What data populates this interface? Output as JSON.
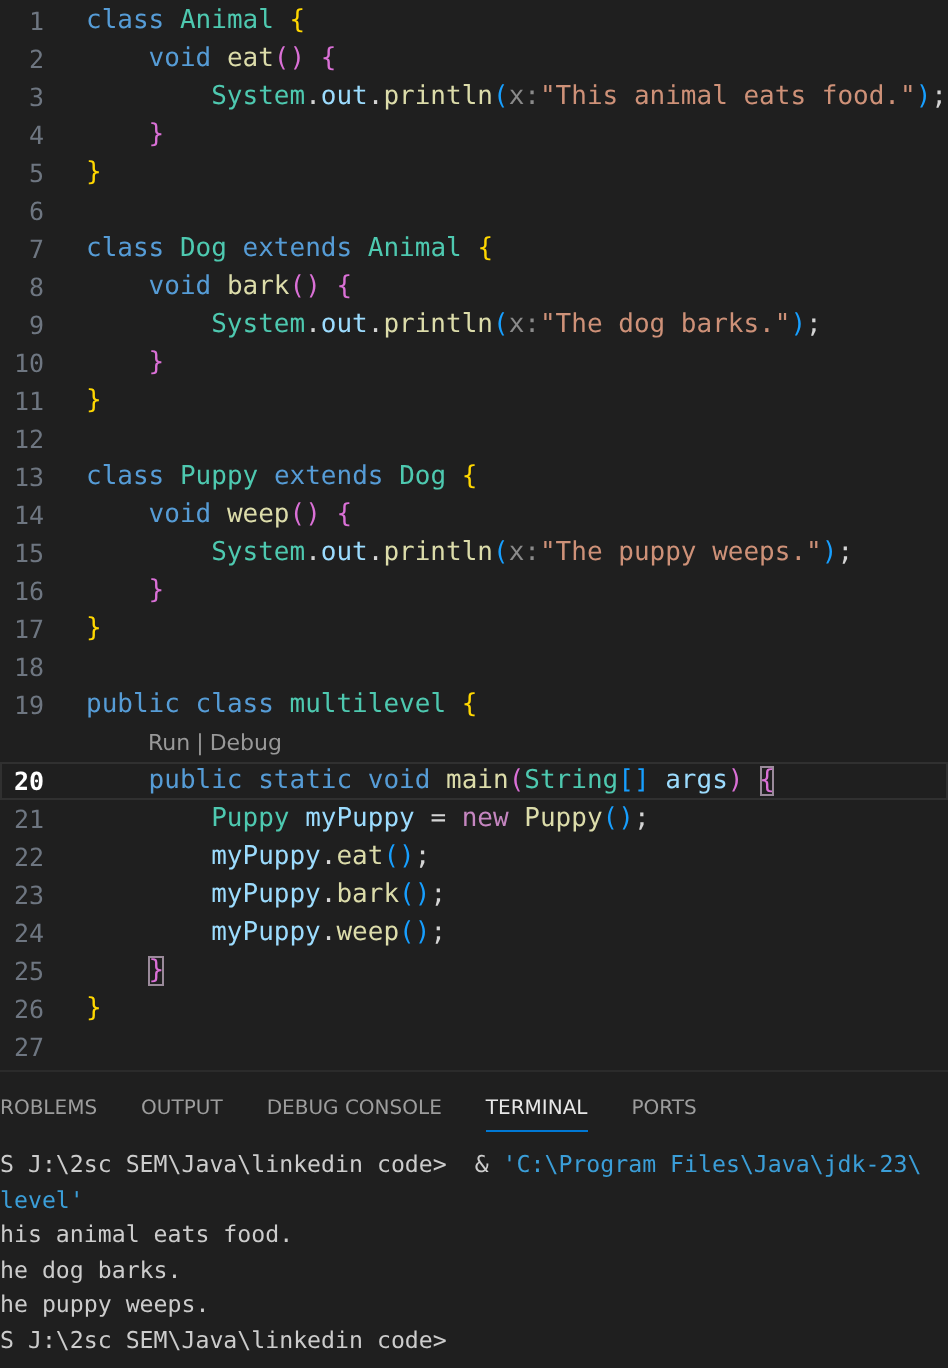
{
  "editor": {
    "lines": [
      {
        "kind": "code",
        "number": "1",
        "active": false,
        "tokens": [
          {
            "text": "class ",
            "kind": "keyword"
          },
          {
            "text": "Animal ",
            "kind": "type"
          },
          {
            "text": "{",
            "kind": "brace1"
          }
        ]
      },
      {
        "kind": "code",
        "number": "2",
        "active": false,
        "tokens": [
          {
            "text": "void ",
            "kind": "keyword"
          },
          {
            "text": "eat",
            "kind": "function"
          },
          {
            "text": "() {",
            "kind": "brace2"
          }
        ]
      },
      {
        "kind": "code",
        "number": "3",
        "active": false,
        "tokens": [
          {
            "text": "System",
            "kind": "type"
          },
          {
            "text": ".",
            "kind": "plain"
          },
          {
            "text": "out",
            "kind": "variable"
          },
          {
            "text": ".",
            "kind": "plain"
          },
          {
            "text": "println",
            "kind": "function"
          },
          {
            "text": "(",
            "kind": "brace3"
          },
          {
            "text": "x:",
            "kind": "hint"
          },
          {
            "text": "\"This animal eats food.\"",
            "kind": "string"
          },
          {
            "text": ")",
            "kind": "brace3"
          },
          {
            "text": ";",
            "kind": "plain"
          }
        ]
      },
      {
        "kind": "code",
        "number": "4",
        "active": false,
        "tokens": [
          {
            "text": "}",
            "kind": "brace2"
          }
        ]
      },
      {
        "kind": "code",
        "number": "5",
        "active": false,
        "tokens": [
          {
            "text": "}",
            "kind": "brace1"
          }
        ]
      },
      {
        "kind": "code",
        "number": "6",
        "active": false
      },
      {
        "kind": "code",
        "number": "7",
        "active": false,
        "tokens": [
          {
            "text": "class ",
            "kind": "keyword"
          },
          {
            "text": "Dog ",
            "kind": "type"
          },
          {
            "text": "extends ",
            "kind": "keyword"
          },
          {
            "text": "Animal ",
            "kind": "type"
          },
          {
            "text": "{",
            "kind": "brace1"
          }
        ]
      },
      {
        "kind": "code",
        "number": "8",
        "active": false,
        "tokens": [
          {
            "text": "void ",
            "kind": "keyword"
          },
          {
            "text": "bark",
            "kind": "function"
          },
          {
            "text": "() {",
            "kind": "brace2"
          }
        ]
      },
      {
        "kind": "code",
        "number": "9",
        "active": false,
        "tokens": [
          {
            "text": "System",
            "kind": "type"
          },
          {
            "text": ".",
            "kind": "plain"
          },
          {
            "text": "out",
            "kind": "variable"
          },
          {
            "text": ".",
            "kind": "plain"
          },
          {
            "text": "println",
            "kind": "function"
          },
          {
            "text": "(",
            "kind": "brace3"
          },
          {
            "text": "x:",
            "kind": "hint"
          },
          {
            "text": "\"The dog barks.\"",
            "kind": "string"
          },
          {
            "text": ")",
            "kind": "brace3"
          },
          {
            "text": ";",
            "kind": "plain"
          }
        ]
      },
      {
        "kind": "code",
        "number": "10",
        "active": false,
        "tokens": [
          {
            "text": "}",
            "kind": "brace2"
          }
        ]
      },
      {
        "kind": "code",
        "number": "11",
        "active": false,
        "tokens": [
          {
            "text": "}",
            "kind": "brace1"
          }
        ]
      },
      {
        "kind": "code",
        "number": "12",
        "active": false
      },
      {
        "kind": "code",
        "number": "13",
        "active": false,
        "tokens": [
          {
            "text": "class ",
            "kind": "keyword"
          },
          {
            "text": "Puppy ",
            "kind": "type"
          },
          {
            "text": "extends ",
            "kind": "keyword"
          },
          {
            "text": "Dog ",
            "kind": "type"
          },
          {
            "text": "{",
            "kind": "brace1"
          }
        ]
      },
      {
        "kind": "code",
        "number": "14",
        "active": false,
        "tokens": [
          {
            "text": "void ",
            "kind": "keyword"
          },
          {
            "text": "weep",
            "kind": "function"
          },
          {
            "text": "() {",
            "kind": "brace2"
          }
        ]
      },
      {
        "kind": "code",
        "number": "15",
        "active": false,
        "tokens": [
          {
            "text": "System",
            "kind": "type"
          },
          {
            "text": ".",
            "kind": "plain"
          },
          {
            "text": "out",
            "kind": "variable"
          },
          {
            "text": ".",
            "kind": "plain"
          },
          {
            "text": "println",
            "kind": "function"
          },
          {
            "text": "(",
            "kind": "brace3"
          },
          {
            "text": "x:",
            "kind": "hint"
          },
          {
            "text": "\"The puppy weeps.\"",
            "kind": "string"
          },
          {
            "text": ")",
            "kind": "brace3"
          },
          {
            "text": ";",
            "kind": "plain"
          }
        ]
      },
      {
        "kind": "code",
        "number": "16",
        "active": false,
        "tokens": [
          {
            "text": "}",
            "kind": "brace2"
          }
        ]
      },
      {
        "kind": "code",
        "number": "17",
        "active": false,
        "tokens": [
          {
            "text": "}",
            "kind": "brace1"
          }
        ]
      },
      {
        "kind": "code",
        "number": "18",
        "active": false
      },
      {
        "kind": "code",
        "number": "19",
        "active": false,
        "tokens": [
          {
            "text": "public class ",
            "kind": "keyword"
          },
          {
            "text": "multilevel ",
            "kind": "type"
          },
          {
            "text": "{",
            "kind": "brace1"
          }
        ]
      },
      {
        "kind": "codelens",
        "links": [
          "Run",
          "Debug"
        ],
        "separator": "|"
      },
      {
        "kind": "code",
        "number": "20",
        "active": true,
        "tokens": [
          {
            "text": "public static void ",
            "kind": "keyword"
          },
          {
            "text": "main",
            "kind": "function"
          },
          {
            "text": "(",
            "kind": "brace2"
          },
          {
            "text": "String",
            "kind": "type"
          },
          {
            "text": "[] ",
            "kind": "brace3"
          },
          {
            "text": "args",
            "kind": "variable"
          },
          {
            "text": ") ",
            "kind": "brace2"
          },
          {
            "text": "{",
            "kind": "match"
          }
        ]
      },
      {
        "kind": "code",
        "number": "21",
        "active": false,
        "tokens": [
          {
            "text": "Puppy ",
            "kind": "type"
          },
          {
            "text": "myPuppy ",
            "kind": "variable"
          },
          {
            "text": "= ",
            "kind": "plain"
          },
          {
            "text": "new ",
            "kind": "control"
          },
          {
            "text": "Puppy",
            "kind": "function"
          },
          {
            "text": "()",
            "kind": "brace3"
          },
          {
            "text": ";",
            "kind": "plain"
          }
        ]
      },
      {
        "kind": "code",
        "number": "22",
        "active": false,
        "tokens": [
          {
            "text": "myPuppy",
            "kind": "variable"
          },
          {
            "text": ".",
            "kind": "plain"
          },
          {
            "text": "eat",
            "kind": "function"
          },
          {
            "text": "()",
            "kind": "brace3"
          },
          {
            "text": ";",
            "kind": "plain"
          }
        ]
      },
      {
        "kind": "code",
        "number": "23",
        "active": false,
        "tokens": [
          {
            "text": "myPuppy",
            "kind": "variable"
          },
          {
            "text": ".",
            "kind": "plain"
          },
          {
            "text": "bark",
            "kind": "function"
          },
          {
            "text": "()",
            "kind": "brace3"
          },
          {
            "text": ";",
            "kind": "plain"
          }
        ]
      },
      {
        "kind": "code",
        "number": "24",
        "active": false,
        "tokens": [
          {
            "text": "myPuppy",
            "kind": "variable"
          },
          {
            "text": ".",
            "kind": "plain"
          },
          {
            "text": "weep",
            "kind": "function"
          },
          {
            "text": "()",
            "kind": "brace3"
          },
          {
            "text": ";",
            "kind": "plain"
          }
        ]
      },
      {
        "kind": "code",
        "number": "25",
        "active": false,
        "tokens": [
          {
            "text": "}",
            "kind": "match"
          }
        ]
      },
      {
        "kind": "code",
        "number": "26",
        "active": false,
        "tokens": [
          {
            "text": "}",
            "kind": "brace1"
          }
        ]
      },
      {
        "kind": "code",
        "number": "27",
        "active": false
      }
    ]
  },
  "panel": {
    "tabs": [
      {
        "label": "ROBLEMS",
        "selected": false
      },
      {
        "label": "OUTPUT",
        "selected": false
      },
      {
        "label": "DEBUG CONSOLE",
        "selected": false
      },
      {
        "label": "TERMINAL",
        "selected": true
      },
      {
        "label": "PORTS",
        "selected": false
      }
    ],
    "terminal_lines": [
      [
        {
          "text": "S J:\\2sc SEM\\Java\\linkedin code>  & ",
          "kind": "plain"
        },
        {
          "text": "'C:\\Program Files\\Java\\jdk-23\\",
          "kind": "string"
        }
      ],
      [
        {
          "text": "level'",
          "kind": "string"
        }
      ],
      [
        {
          "text": "his animal eats food.",
          "kind": "plain"
        }
      ],
      [
        {
          "text": "he dog barks.",
          "kind": "plain"
        }
      ],
      [
        {
          "text": "he puppy weeps.",
          "kind": "plain"
        }
      ],
      [
        {
          "text": "S J:\\2sc SEM\\Java\\linkedin code>",
          "kind": "plain"
        }
      ]
    ]
  }
}
